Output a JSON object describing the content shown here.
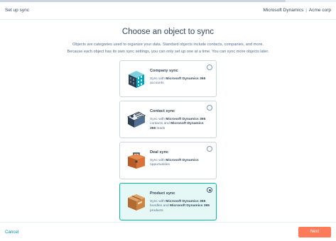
{
  "header": {
    "title": "Set up sync",
    "app_name": "Microsoft Dynamics",
    "separator": "|",
    "account": "Acme corp"
  },
  "progress": {
    "fraction": 0.85
  },
  "main": {
    "title": "Choose an object to sync",
    "description_line1": "Objects are categories used to organize your data. Standard objects include contacts, companies, and more.",
    "description_line2": "Because each object has its own sync settings, you can only set up one at a time. You can sync more objects later."
  },
  "options": [
    {
      "id": "company",
      "title": "Company sync",
      "icon": "company-building-icon",
      "desc_pre": "Sync with ",
      "desc_bold1": "Microsoft Dynamics 365",
      "desc_mid": " accounts",
      "desc_bold2": "",
      "desc_post": "",
      "selected": false
    },
    {
      "id": "contact",
      "title": "Contact sync",
      "icon": "contact-card-icon",
      "desc_pre": "Sync with ",
      "desc_bold1": "Microsoft Dynamics 365",
      "desc_mid": " contacts and ",
      "desc_bold2": "Microsoft Dynamics 365",
      "desc_post": " leads",
      "selected": false
    },
    {
      "id": "deal",
      "title": "Deal sync",
      "icon": "briefcase-icon",
      "desc_pre": "Sync with ",
      "desc_bold1": "Microsoft Dynamics",
      "desc_mid": " opportunities",
      "desc_bold2": "",
      "desc_post": "",
      "selected": false
    },
    {
      "id": "product",
      "title": "Product sync",
      "icon": "product-box-icon",
      "desc_pre": "Sync with ",
      "desc_bold1": "Microsoft Dynamics 365",
      "desc_mid": " bundles and ",
      "desc_bold2": "Microsoft Dynamics 365",
      "desc_post": " products",
      "selected": true
    }
  ],
  "footer": {
    "cancel_label": "Cancel",
    "next_label": "Next"
  },
  "colors": {
    "accent_teal": "#00bda5",
    "selected_bg": "#e5f8f6",
    "primary_button": "#ff7a59",
    "link": "#0091ae"
  }
}
